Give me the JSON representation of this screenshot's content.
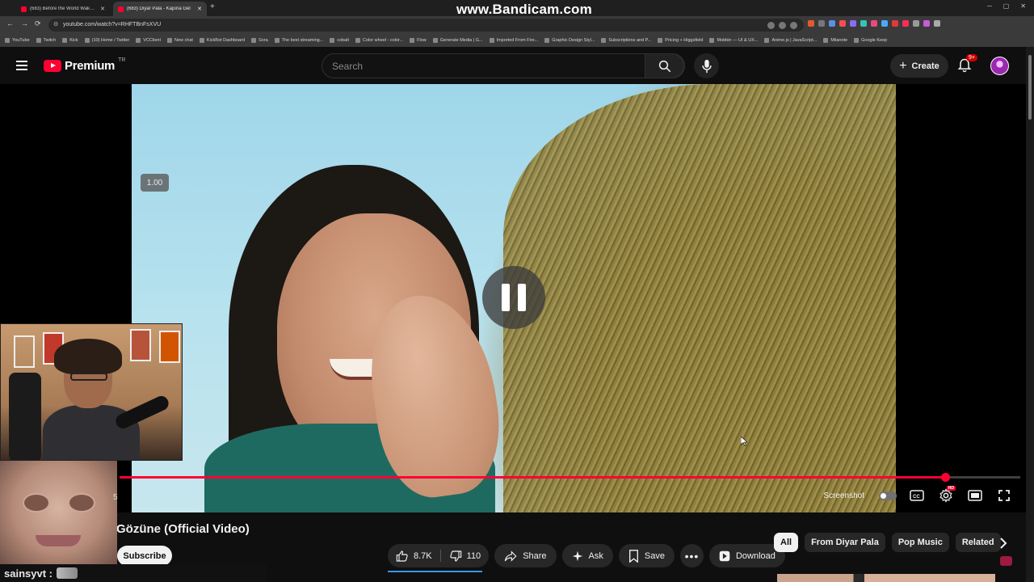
{
  "browser": {
    "tabs": [
      {
        "title": "(683) Before the World Wakes U",
        "active": false
      },
      {
        "title": "(683) Diyar Pala - Kapına Gel",
        "active": true
      }
    ],
    "url": "youtube.com/watch?v=RHFTBnFsXVU",
    "bookmarks": [
      "YouTube",
      "Twitch",
      "Kick",
      "(10) Home / Twitter",
      "VCClient",
      "New chat",
      "KickBot Dashboard",
      "Sora",
      "The best streaming...",
      "cobalt",
      "Color wheel - color...",
      "Flow",
      "Generate Media | G...",
      "Imported From Fire...",
      "Graphic Design Styl...",
      "Subscriptions and P...",
      "Pricing + Higgsfield",
      "Mobbin — UI & UX...",
      "Anime.js | JavaScript...",
      "Milanote",
      "Google Keep"
    ]
  },
  "watermark": "www.Bandicam.com",
  "header": {
    "logo_text": "Premium",
    "country_code": "TR",
    "search_placeholder": "Search",
    "create_label": "Create",
    "notifications_badge": "9+"
  },
  "player": {
    "speed_badge": "1.00",
    "progress_fraction": 0.917,
    "screenshot_label": "Screenshot",
    "hd_badge": "HD",
    "timestamp_fragment": "5"
  },
  "video": {
    "title": "Gözüne (Official Video)",
    "subscribe_label": "Subscribe",
    "likes": "8.7K",
    "dislikes": "110",
    "share_label": "Share",
    "ask_label": "Ask",
    "save_label": "Save",
    "download_label": "Download"
  },
  "chips": [
    "All",
    "From Diyar Pala",
    "Pop Music",
    "Related"
  ],
  "overlay": {
    "chat_user": "sainsyvt :"
  },
  "colors": {
    "accent_red": "#ff0033",
    "background": "#0f0f0f",
    "pill": "#272727"
  }
}
